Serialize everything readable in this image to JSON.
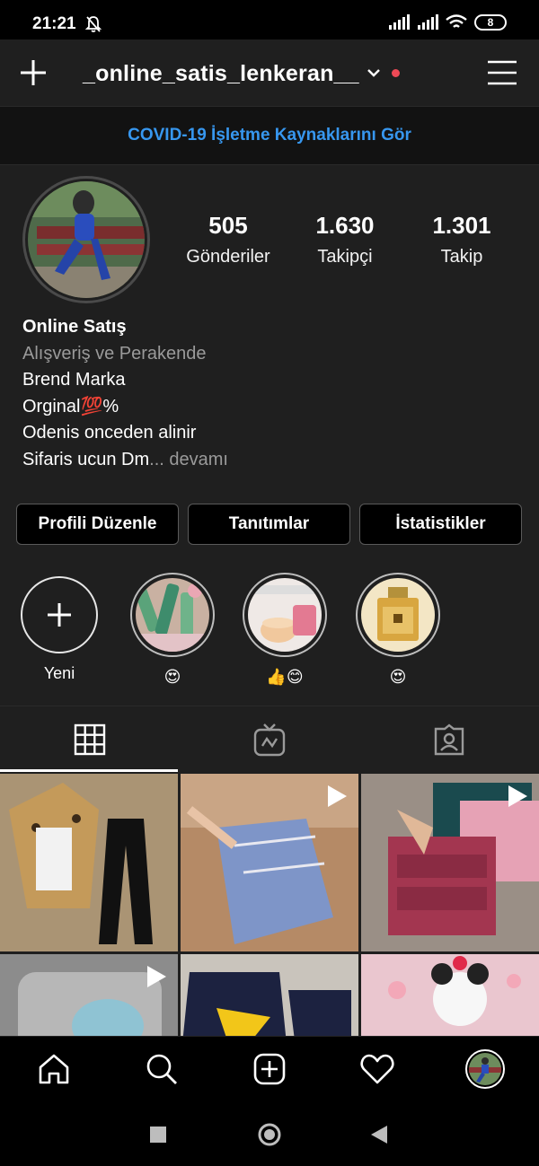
{
  "status_bar": {
    "time": "21:21",
    "battery": "8",
    "icons": [
      "bell-mute-icon",
      "signal-icon",
      "signal-icon",
      "wifi-icon",
      "battery-icon"
    ]
  },
  "header": {
    "username": "_online_satis_lenkeran__",
    "icons": [
      "plus-icon",
      "chevron-down-icon",
      "notification-dot",
      "menu-icon"
    ],
    "dot_color": "#ed4956"
  },
  "banner": {
    "text": "COVID-19 İşletme Kaynaklarını Gör",
    "color": "#3797ef"
  },
  "stats": [
    {
      "value": "505",
      "label": "Gönderiler"
    },
    {
      "value": "1.630",
      "label": "Takipçi"
    },
    {
      "value": "1.301",
      "label": "Takip"
    }
  ],
  "bio": {
    "name": "Online Satış",
    "category": "Alışveriş ve Perakende",
    "lines": [
      "Brend Marka",
      "Orginal💯%",
      "Odenis onceden alinir"
    ],
    "last_line": "Sifaris ucun Dm",
    "more": "... devamı"
  },
  "buttons": {
    "edit_profile": "Profili Düzenle",
    "promotions": "Tanıtımlar",
    "insights": "İstatistikler"
  },
  "highlights": [
    {
      "label": "Yeni",
      "icon": "plus-icon"
    },
    {
      "label": "😍"
    },
    {
      "label": "👍😊"
    },
    {
      "label": "😍"
    }
  ],
  "tabs": [
    "grid-icon",
    "igtv-icon",
    "tagged-icon"
  ],
  "posts": [
    {
      "type": "photo"
    },
    {
      "type": "video"
    },
    {
      "type": "video"
    },
    {
      "type": "video"
    },
    {
      "type": "photo"
    },
    {
      "type": "photo"
    }
  ],
  "bottom_nav": [
    "home-icon",
    "search-icon",
    "add-icon",
    "heart-icon",
    "profile-avatar"
  ],
  "system_nav": [
    "square-icon",
    "circle-icon",
    "back-triangle-icon"
  ]
}
